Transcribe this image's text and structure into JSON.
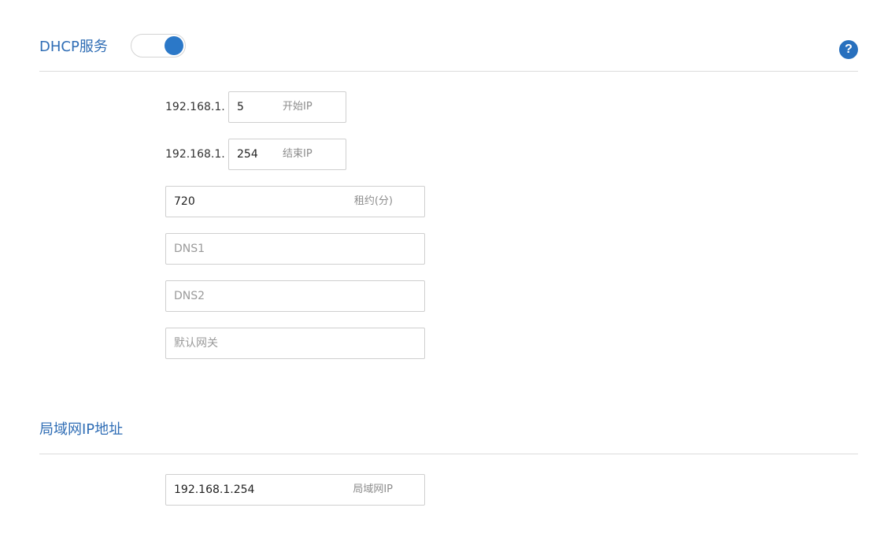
{
  "dhcp": {
    "title": "DHCP服务",
    "toggle_on": true,
    "help_glyph": "?",
    "start_ip": {
      "prefix": "192.168.1.",
      "value": "5",
      "suffix": "开始IP"
    },
    "end_ip": {
      "prefix": "192.168.1.",
      "value": "254",
      "suffix": "结束IP"
    },
    "lease": {
      "value": "720",
      "suffix": "租约(分)"
    },
    "dns1": {
      "value": "",
      "placeholder": "DNS1"
    },
    "dns2": {
      "value": "",
      "placeholder": "DNS2"
    },
    "gateway": {
      "value": "",
      "placeholder": "默认网关"
    }
  },
  "lan": {
    "title": "局域网IP地址",
    "ip": {
      "value": "192.168.1.254",
      "suffix": "局域网IP"
    }
  },
  "colors": {
    "accent": "#2f6db5",
    "toggle_knob": "#2b78c8",
    "help_icon": "#2870be"
  },
  "icons": {
    "help": "help-icon",
    "toggle": "toggle-switch"
  }
}
